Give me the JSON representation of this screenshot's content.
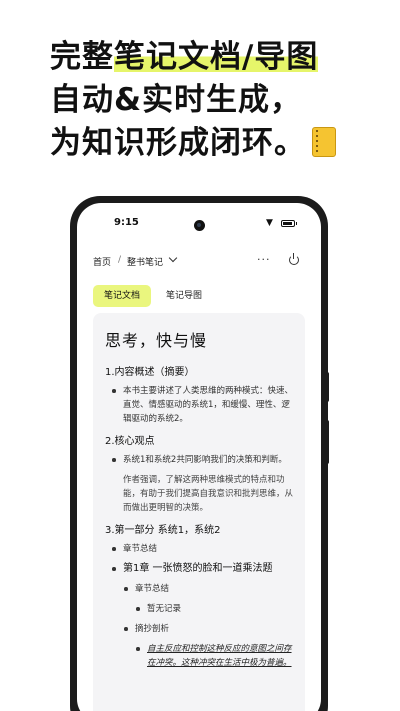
{
  "headline": {
    "line1_pre": "完整",
    "line1_mark": "笔记文档/导图",
    "line2": "自动&实时生成，",
    "line3": "为知识形成闭环。",
    "emoji_icon": "notebook-icon"
  },
  "status": {
    "time": "9:15",
    "wifi": "▼"
  },
  "nav": {
    "home": "首页",
    "sep": "/",
    "current": "整书笔记",
    "more": "···"
  },
  "tabs": [
    {
      "label": "笔记文档",
      "active": true
    },
    {
      "label": "笔记导图",
      "active": false
    }
  ],
  "colors": {
    "accent": "#eaf67e",
    "card_bg": "#f4f4f6",
    "phone_frame": "#1b1b1b"
  },
  "doc": {
    "title": "思考，快与慢",
    "s1": "1.内容概述（摘要）",
    "s1_b1": "本书主要讲述了人类思维的两种模式：快速、直觉、情感驱动的系统1，和缓慢、理性、逻辑驱动的系统2。",
    "s2": "2.核心观点",
    "s2_b1": "系统1和系统2共同影响我们的决策和判断。",
    "s2_p1": "作者强调，了解这两种思维模式的特点和功能，有助于我们提高自我意识和批判思维，从而做出更明智的决策。",
    "s3": "3.第一部分 系统1，系统2",
    "s3_b1": "章节总结",
    "s3_b2": "第1章 一张愤怒的脸和一道乘法题",
    "s3_b3": "章节总结",
    "s3_b4": "暂无记录",
    "s3_b5": "摘抄剖析",
    "s3_b6": "自主反应和控制这种反应的意图之间存在冲突。这种冲突在生活中极为普遍。"
  }
}
